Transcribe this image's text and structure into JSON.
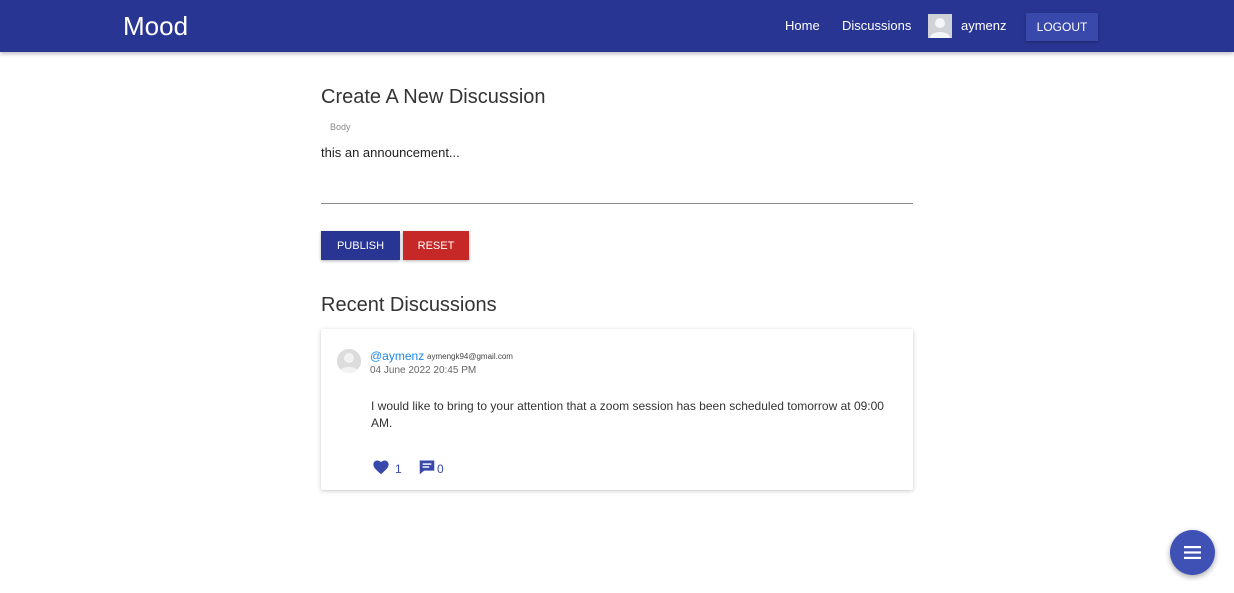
{
  "navbar": {
    "brand": "Mood",
    "links": {
      "home": "Home",
      "discussions": "Discussions"
    },
    "user": {
      "name": "aymenz",
      "avatar_icon": "user-avatar-icon"
    },
    "logout_label": "LOGOUT",
    "color": "#283593"
  },
  "create": {
    "title": "Create A New Discussion",
    "body_label": "Body",
    "body_value": "this an announcement...",
    "publish_label": "PUBLISH",
    "reset_label": "RESET"
  },
  "recent": {
    "title": "Recent Discussions",
    "posts": [
      {
        "handle": "@aymenz",
        "email": "aymengk94@gmail.com",
        "date": "04 June 2022 20:45 PM",
        "body": "I would like to bring to your attention that a zoom session has been scheduled tomorrow at 09:00 AM.",
        "likes": "1",
        "comments": "0"
      }
    ]
  },
  "fab": {
    "icon": "menu-icon"
  },
  "colors": {
    "primary": "#283593",
    "accent": "#3f51b5",
    "danger": "#c62828",
    "link": "#1e88e5"
  }
}
